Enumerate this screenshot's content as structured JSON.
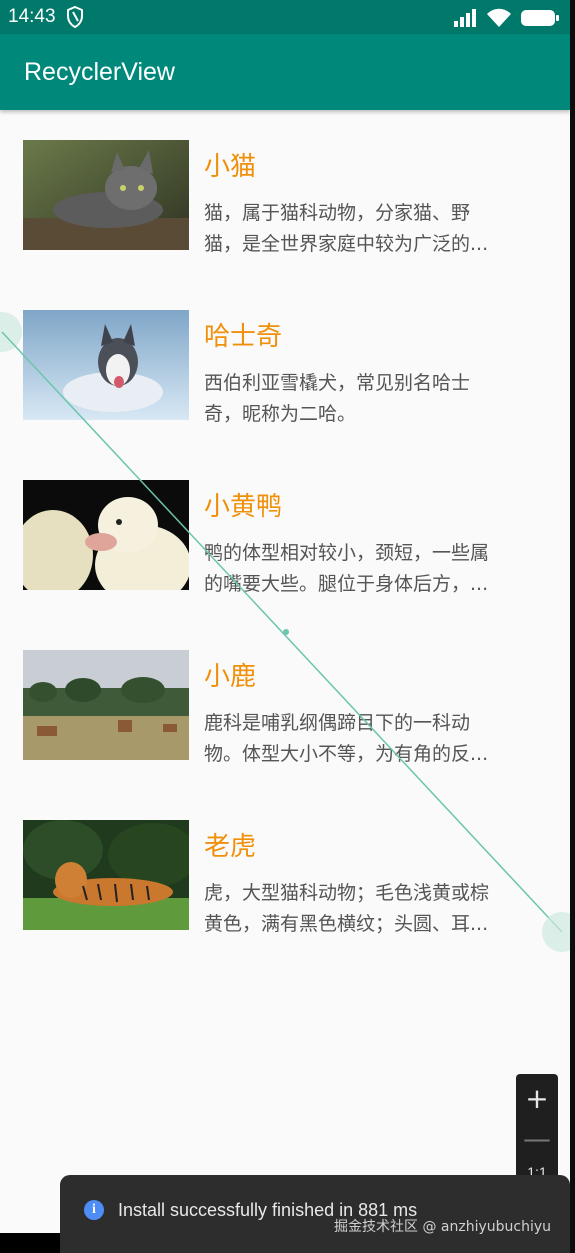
{
  "status_bar": {
    "time": "14:43",
    "icons": [
      "shield-icon",
      "signal-icon",
      "wifi-icon",
      "battery-icon"
    ]
  },
  "app_bar": {
    "title": "RecyclerView"
  },
  "items": [
    {
      "title": "小猫",
      "desc_lines": [
        "猫，属于猫科动物，分家猫、野",
        "猫，是全世界家庭中较为广泛的..."
      ],
      "image": "kitten-photo"
    },
    {
      "title": "哈士奇",
      "desc_lines": [
        "西伯利亚雪橇犬，常见别名哈士",
        "奇，昵称为二哈。"
      ],
      "image": "husky-photo"
    },
    {
      "title": "小黄鸭",
      "desc_lines": [
        "鸭的体型相对较小，颈短，一些属",
        "的嘴要大些。腿位于身体后方，..."
      ],
      "image": "duckling-photo"
    },
    {
      "title": "小鹿",
      "desc_lines": [
        "鹿科是哺乳纲偶蹄目下的一科动",
        "物。体型大小不等，为有角的反..."
      ],
      "image": "deer-photo"
    },
    {
      "title": "老虎",
      "desc_lines": [
        "虎，大型猫科动物；毛色浅黄或棕",
        "黄色，满有黑色横纹；头圆、耳..."
      ],
      "image": "tiger-photo"
    }
  ],
  "zoom": {
    "plus": "+",
    "minus": "—",
    "ratio": "1:1"
  },
  "toast": {
    "icon": "info-icon",
    "message": "Install successfully finished in 881 ms"
  },
  "watermark": "掘金技术社区 @ anzhiyubuchiyu",
  "colors": {
    "status_bar": "#00796b",
    "app_bar": "#00897b",
    "title": "#f0900a",
    "desc": "#555555"
  }
}
